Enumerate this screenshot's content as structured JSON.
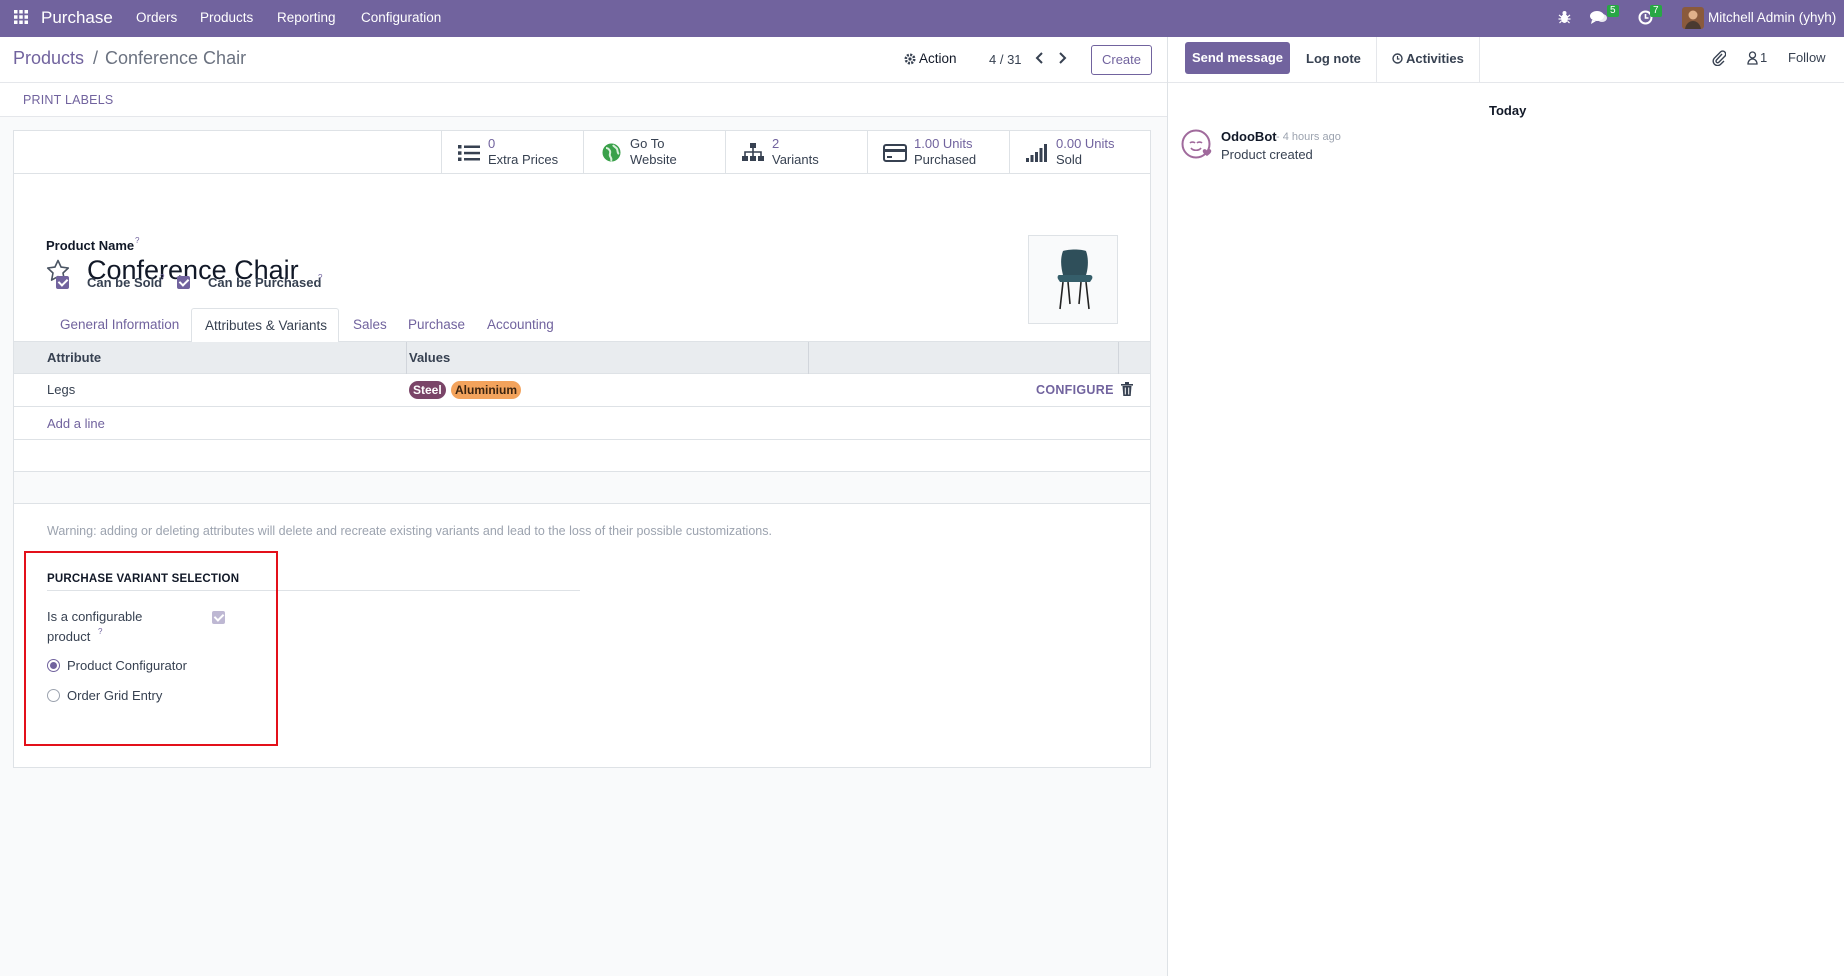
{
  "topbar": {
    "app_name": "Purchase",
    "menu": [
      "Orders",
      "Products",
      "Reporting",
      "Configuration"
    ],
    "messages_count": "5",
    "activities_count": "7",
    "user_name": "Mitchell Admin (yhyh)"
  },
  "breadcrumb": {
    "parent": "Products",
    "separator": "/",
    "current": "Conference Chair"
  },
  "controls": {
    "action_label": "Action",
    "pager": "4 / 31",
    "create_label": "Create",
    "print_labels": "PRINT LABELS"
  },
  "stat_buttons": [
    {
      "value": "0",
      "label": "Extra Prices",
      "icon": "list-icon"
    },
    {
      "value": "Go To",
      "label": "Website",
      "icon": "globe-icon"
    },
    {
      "value": "2",
      "label": "Variants",
      "icon": "sitemap-icon"
    },
    {
      "value": "1.00 Units",
      "label": "Purchased",
      "icon": "credit-card-icon"
    },
    {
      "value": "0.00 Units",
      "label": "Sold",
      "icon": "signal-icon"
    }
  ],
  "product": {
    "name_label": "Product Name",
    "tooltip_mark": "?",
    "name": "Conference Chair",
    "can_be_sold_label": "Can be Sold",
    "can_be_purchased_label": "Can be Purchased",
    "can_be_sold": true,
    "can_be_purchased": true
  },
  "tabs": [
    "General Information",
    "Attributes & Variants",
    "Sales",
    "Purchase",
    "Accounting"
  ],
  "active_tab": "Attributes & Variants",
  "attributes_table": {
    "headers": [
      "Attribute",
      "Values"
    ],
    "rows": [
      {
        "attribute": "Legs",
        "values": [
          "Steel",
          "Aluminium"
        ],
        "configure_label": "CONFIGURE"
      }
    ],
    "add_line": "Add a line"
  },
  "warning": {
    "label": "Warning:",
    "text": "adding or deleting attributes will delete and recreate existing variants and lead to the loss of their possible customizations."
  },
  "variant_selection": {
    "title": "PURCHASE VARIANT SELECTION",
    "configurable_label_1": "Is a configurable",
    "configurable_label_2": "product",
    "configurable_checked": true,
    "options": [
      "Product Configurator",
      "Order Grid Entry"
    ],
    "selected": "Product Configurator"
  },
  "chatter": {
    "send_message": "Send message",
    "log_note": "Log note",
    "activities": "Activities",
    "followers_count": "1",
    "follow": "Follow",
    "date_separator": "Today",
    "messages": [
      {
        "author": "OdooBot",
        "time": "- 4 hours ago",
        "body": "Product created"
      }
    ]
  },
  "colors": {
    "brand": "#71639e",
    "steel_tag": "#7a4568",
    "aluminium_tag": "#f3a35c",
    "highlight_box": "#e3101a"
  }
}
